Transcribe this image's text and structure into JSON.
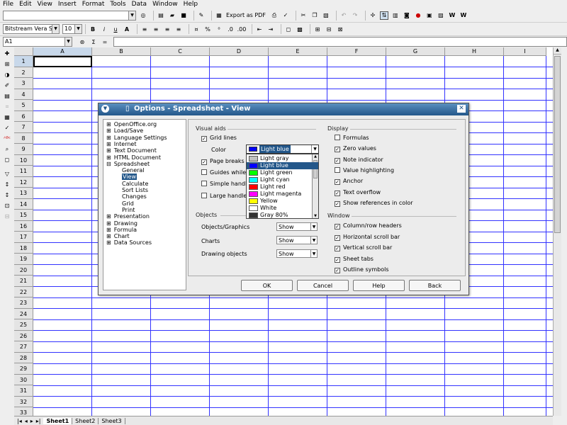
{
  "menu": [
    "File",
    "Edit",
    "View",
    "Insert",
    "Format",
    "Tools",
    "Data",
    "Window",
    "Help"
  ],
  "toolbar": {
    "export_pdf": "Export as PDF"
  },
  "format": {
    "font": "Bitstream Vera Sa",
    "size": "10"
  },
  "namebox": "A1",
  "cols": [
    "A",
    "B",
    "C",
    "D",
    "E",
    "F",
    "G",
    "H",
    "I"
  ],
  "rows": [
    "1",
    "2",
    "3",
    "4",
    "5",
    "6",
    "7",
    "8",
    "9",
    "10",
    "11",
    "12",
    "13",
    "14",
    "15",
    "16",
    "17",
    "18",
    "19",
    "20",
    "21",
    "22",
    "23",
    "24",
    "25",
    "26",
    "27",
    "28",
    "29",
    "30",
    "31",
    "32",
    "33"
  ],
  "sheets": [
    "Sheet1",
    "Sheet2",
    "Sheet3"
  ],
  "dialog": {
    "title": "Options - Spreadsheet - View",
    "tree": [
      "OpenOffice.org",
      "Load/Save",
      "Language Settings",
      "Internet",
      "Text Document",
      "HTML Document",
      "Spreadsheet",
      "General",
      "View",
      "Calculate",
      "Sort Lists",
      "Changes",
      "Grid",
      "Print",
      "Presentation",
      "Drawing",
      "Formula",
      "Chart",
      "Data Sources"
    ],
    "visual_aids": {
      "title": "Visual aids",
      "grid_lines": "Grid lines",
      "color": "Color",
      "page_breaks": "Page breaks",
      "guides": "Guides while",
      "simple": "Simple handl",
      "large": "Large handle"
    },
    "color_value": "Light blue",
    "colors": [
      {
        "name": "Light gray",
        "hex": "#c0c0c0"
      },
      {
        "name": "Light blue",
        "hex": "#0000ff"
      },
      {
        "name": "Light green",
        "hex": "#00ff00"
      },
      {
        "name": "Light cyan",
        "hex": "#00ffff"
      },
      {
        "name": "Light red",
        "hex": "#ff0000"
      },
      {
        "name": "Light magenta",
        "hex": "#ff00ff"
      },
      {
        "name": "Yellow",
        "hex": "#ffff00"
      },
      {
        "name": "White",
        "hex": "#ffffff"
      },
      {
        "name": "Gray 80%",
        "hex": "#333333"
      }
    ],
    "objects": {
      "title": "Objects",
      "graphics": "Objects/Graphics",
      "charts": "Charts",
      "drawing": "Drawing objects",
      "value": "Show"
    },
    "display": {
      "title": "Display",
      "items": [
        "Formulas",
        "Zero values",
        "Note indicator",
        "Value highlighting",
        "Anchor",
        "Text overflow",
        "Show references in color"
      ]
    },
    "window": {
      "title": "Window",
      "items": [
        "Column/row headers",
        "Horizontal scroll bar",
        "Vertical scroll bar",
        "Sheet tabs",
        "Outline symbols"
      ]
    },
    "buttons": {
      "ok": "OK",
      "cancel": "Cancel",
      "help": "Help",
      "back": "Back"
    }
  }
}
